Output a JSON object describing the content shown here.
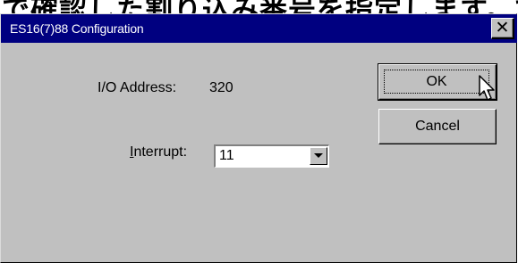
{
  "backdrop": {
    "text": "で確認した割り込み番号を指定します。で"
  },
  "dialog": {
    "title": "ES16(7)88 Configuration",
    "close_icon": "close-icon",
    "io_address_label": "I/O Address:",
    "io_address_value": "320",
    "interrupt_label_mnemonic": "I",
    "interrupt_label_rest": "nterrupt:",
    "interrupt_value": "11",
    "ok_label": "OK",
    "cancel_label": "Cancel"
  },
  "colors": {
    "titlebar": "#000080",
    "face": "#c0c0c0"
  },
  "icons": {
    "close": "close-icon",
    "dropdown": "chevron-down-icon",
    "cursor": "mouse-pointer-icon"
  }
}
